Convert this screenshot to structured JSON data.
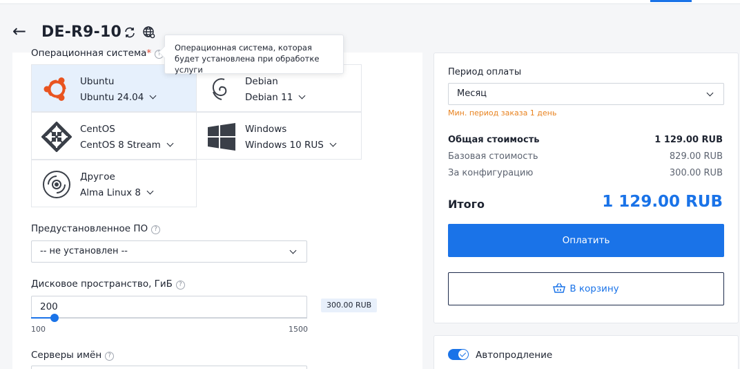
{
  "header": {
    "back_label": "←",
    "title": "DE-R9-10"
  },
  "tooltip": {
    "text": "Операционная система, которая будет установлена при обработке услуги"
  },
  "os": {
    "label": "Операционная система",
    "required_mark": "*",
    "help": "?",
    "options": [
      {
        "name": "Ubuntu",
        "version": "Ubuntu 24.04",
        "icon": "ubuntu-logo",
        "selected": true
      },
      {
        "name": "Debian",
        "version": "Debian 11",
        "icon": "debian-logo",
        "selected": false
      },
      {
        "name": "CentOS",
        "version": "CentOS 8 Stream",
        "icon": "centos-logo",
        "selected": false
      },
      {
        "name": "Windows",
        "version": "Windows 10 RUS",
        "icon": "windows-logo",
        "selected": false
      },
      {
        "name": "Другое",
        "version": "Alma Linux 8",
        "icon": "disc-icon",
        "selected": false
      }
    ]
  },
  "preinstalled": {
    "label": "Предустановленное ПО",
    "help": "?",
    "value": "-- не установлен --"
  },
  "disk": {
    "label": "Дисковое пространство, ГиБ",
    "help": "?",
    "value": "200",
    "min": "100",
    "max": "1500",
    "price": "300.00 RUB"
  },
  "nameservers": {
    "label": "Серверы имён",
    "help": "?"
  },
  "order": {
    "period_label": "Период оплаты",
    "period_value": "Месяц",
    "period_note": "Мин. период заказа 1 день",
    "total_cost_label": "Общая стоимость",
    "total_cost_value": "1 129.00 RUB",
    "base_cost_label": "Базовая стоимость",
    "base_cost_value": "829.00 RUB",
    "config_cost_label": "За конфигурацию",
    "config_cost_value": "300.00 RUB",
    "grand_total_label": "Итого",
    "grand_total_value": "1 129.00 RUB",
    "pay_button": "Оплатить",
    "cart_button": "В корзину"
  },
  "autorenew": {
    "label": "Автопродление",
    "enabled": true
  },
  "colors": {
    "accent": "#1a73e8",
    "warning": "#e8821e",
    "selected_bg": "#e6f0fc"
  }
}
